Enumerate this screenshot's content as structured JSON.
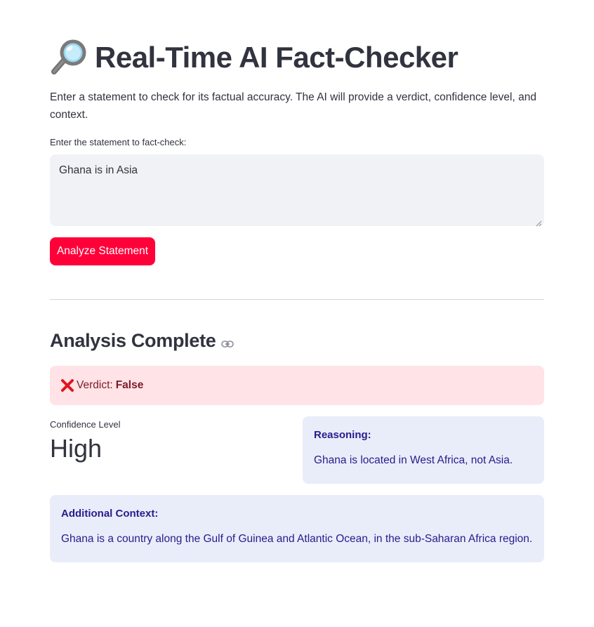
{
  "header": {
    "title": "Real-Time AI Fact-Checker",
    "icon": "magnifying-glass-icon"
  },
  "intro": "Enter a statement to check for its factual accuracy. The AI will provide a verdict, confidence level, and context.",
  "input": {
    "label": "Enter the statement to fact-check:",
    "value": "Ghana is in Asia"
  },
  "analyze_button": {
    "label": "Analyze Statement",
    "color": "#ff0039"
  },
  "result": {
    "heading": "Analysis Complete",
    "verdict_label": "Verdict:",
    "verdict_value": "False",
    "confidence_label": "Confidence Level",
    "confidence_value": "High",
    "reasoning_title": "Reasoning:",
    "reasoning_text": "Ghana is located in West Africa, not Asia.",
    "context_title": "Additional Context:",
    "context_text": "Ghana is a country along the Gulf of Guinea and Atlantic Ocean, in the sub-Saharan Africa region."
  },
  "colors": {
    "error_bg": "#ffe3e6",
    "info_bg": "#e9edfa",
    "info_text": "#2a1a8c",
    "input_bg": "#f0f2f6"
  }
}
